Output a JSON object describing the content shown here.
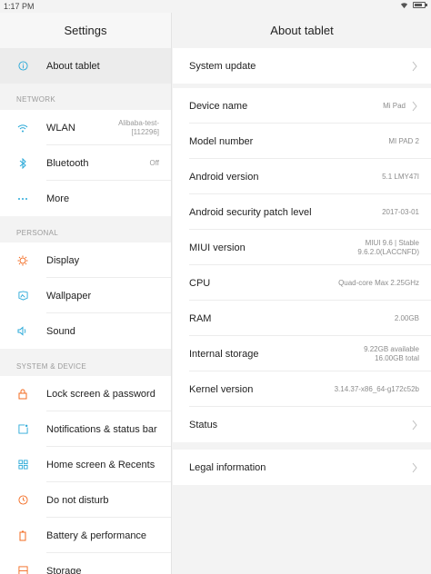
{
  "status_bar": {
    "time": "1:17 PM"
  },
  "left": {
    "title": "Settings",
    "selected_item": "About tablet",
    "sections": {
      "network": "NETWORK",
      "personal": "PERSONAL",
      "system": "SYSTEM & DEVICE"
    },
    "items": {
      "wlan": {
        "label": "WLAN",
        "value_line1": "Alibaba-test-",
        "value_line2": "[112296]"
      },
      "bluetooth": {
        "label": "Bluetooth",
        "value": "Off"
      },
      "more": {
        "label": "More"
      },
      "display": {
        "label": "Display"
      },
      "wallpaper": {
        "label": "Wallpaper"
      },
      "sound": {
        "label": "Sound"
      },
      "lock_screen": {
        "label": "Lock screen & password"
      },
      "notifications": {
        "label": "Notifications & status bar"
      },
      "home_screen": {
        "label": "Home screen & Recents"
      },
      "dnd": {
        "label": "Do not disturb"
      },
      "battery": {
        "label": "Battery & performance"
      },
      "storage": {
        "label": "Storage"
      }
    }
  },
  "right": {
    "title": "About tablet",
    "system_update": "System update",
    "rows": {
      "device_name": {
        "label": "Device name",
        "value": "Mi Pad"
      },
      "model": {
        "label": "Model number",
        "value": "MI PAD 2"
      },
      "android": {
        "label": "Android version",
        "value": "5.1 LMY47I"
      },
      "patch": {
        "label": "Android security patch level",
        "value": "2017-03-01"
      },
      "miui": {
        "label": "MIUI version",
        "value_line1": "MIUI 9.6 | Stable",
        "value_line2": "9.6.2.0(LACCNFD)"
      },
      "cpu": {
        "label": "CPU",
        "value": "Quad-core Max 2.25GHz"
      },
      "ram": {
        "label": "RAM",
        "value": "2.00GB"
      },
      "internal_storage": {
        "label": "Internal storage",
        "value_line1": "9.22GB available",
        "value_line2": "16.00GB total"
      },
      "kernel": {
        "label": "Kernel version",
        "value": "3.14.37-x86_64-g172c52b"
      },
      "status": {
        "label": "Status"
      }
    },
    "legal": "Legal information"
  },
  "colors": {
    "accent": "#f36b21",
    "icon_blue": "#2aa9d8"
  }
}
